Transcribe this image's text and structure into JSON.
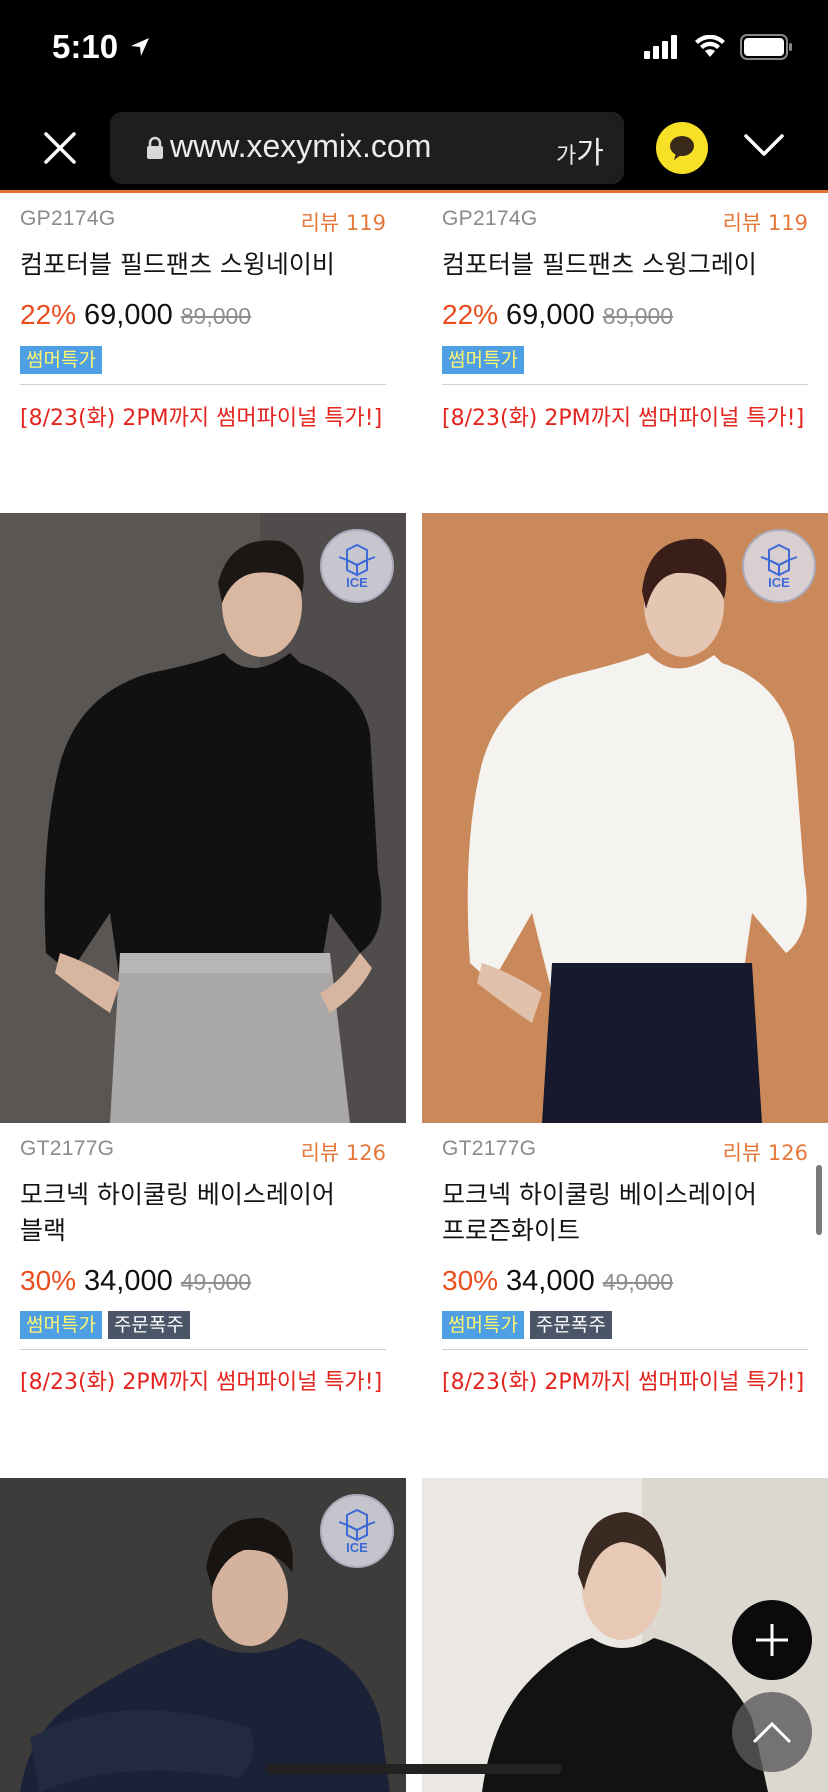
{
  "status": {
    "time": "5:10"
  },
  "browser": {
    "url": "www.xexymix.com",
    "text_size_small": "가",
    "text_size_large": "가"
  },
  "colors": {
    "discount": "#ea4e1e",
    "review": "#e5783a",
    "promo": "#e4241e",
    "summer_badge_bg": "#4e9fe4",
    "summer_badge_text": "#fff56e",
    "hot_badge_bg": "#4b5568"
  },
  "products": [
    {
      "code": "GP2174G",
      "review": "리뷰 119",
      "name": "컴포터블 필드팬츠 스윙네이비",
      "discount": "22%",
      "price": "69,000",
      "original_price": "89,000",
      "badges": [
        "썸머특가"
      ],
      "promo": "[8/23(화) 2PM까지 썸머파이널 특가!]"
    },
    {
      "code": "GP2174G",
      "review": "리뷰 119",
      "name": "컴포터블 필드팬츠 스윙그레이",
      "discount": "22%",
      "price": "69,000",
      "original_price": "89,000",
      "badges": [
        "썸머특가"
      ],
      "promo": "[8/23(화) 2PM까지 썸머파이널 특가!]"
    },
    {
      "code": "GT2177G",
      "review": "리뷰 126",
      "name_line1": "모크넥 하이쿨링 베이스레이어",
      "name_line2": "블랙",
      "discount": "30%",
      "price": "34,000",
      "original_price": "49,000",
      "badges": [
        "썸머특가",
        "주문폭주"
      ],
      "promo": "[8/23(화) 2PM까지 썸머파이널 특가!]",
      "ice_label": "ICE"
    },
    {
      "code": "GT2177G",
      "review": "리뷰 126",
      "name_line1": "모크넥 하이쿨링 베이스레이어",
      "name_line2": "프로즌화이트",
      "discount": "30%",
      "price": "34,000",
      "original_price": "49,000",
      "badges": [
        "썸머특가",
        "주문폭주"
      ],
      "promo": "[8/23(화) 2PM까지 썸머파이널 특가!]",
      "ice_label": "ICE"
    },
    {
      "ice_label": "ICE"
    },
    {}
  ]
}
